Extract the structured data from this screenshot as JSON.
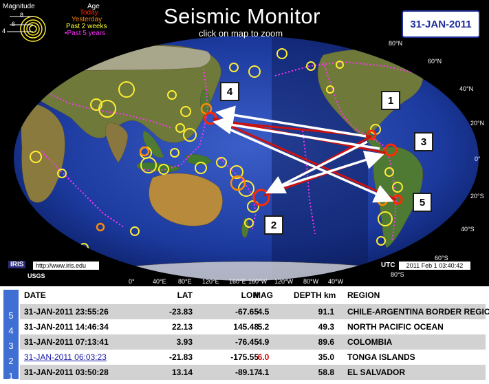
{
  "legend": {
    "magnitude_title": "Magnitude",
    "age_title": "Age",
    "scale": [
      "8",
      "6",
      "4"
    ],
    "ages": [
      {
        "label": "Today",
        "color": "#ff2a00"
      },
      {
        "label": "Yesterday",
        "color": "#ff8a00"
      },
      {
        "label": "Past 2 weeks",
        "color": "#ffff33"
      },
      {
        "label": "•Past 5 years",
        "color": "#ff33ff"
      }
    ]
  },
  "header": {
    "title": "Seismic Monitor",
    "subtitle": "click on map to zoom",
    "date_badge": "31-JAN-2011"
  },
  "map": {
    "lat_labels": [
      "80°N",
      "60°N",
      "40°N",
      "20°N",
      "0°",
      "20°S",
      "40°S",
      "60°S",
      "80°S"
    ],
    "lon_labels": [
      "0°",
      "40°E",
      "80°E",
      "120°E",
      "160°E",
      "160°W",
      "120°W",
      "80°W",
      "40°W"
    ],
    "iris_logo": "IRIS",
    "iris_url": "http://www.iris.edu",
    "usgs_logo": "USGS",
    "utc_label": "UTC",
    "utc_time": "2011 Feb  1 03:40:42",
    "callouts": [
      "1",
      "2",
      "3",
      "4",
      "5"
    ]
  },
  "table": {
    "headers": {
      "date": "DATE",
      "lat": "LAT",
      "lon": "LON",
      "mag": "MAG",
      "depth": "DEPTH km",
      "region": "REGION"
    },
    "rows": [
      {
        "rank": "5",
        "date": "31-JAN-2011 23:55:26",
        "lat": "-23.83",
        "lon": "-67.65",
        "mag": "4.5",
        "depth": "91.1",
        "region": "CHILE-ARGENTINA BORDER REGION"
      },
      {
        "rank": "4",
        "date": "31-JAN-2011 14:46:34",
        "lat": "22.13",
        "lon": "145.48",
        "mag": "5.2",
        "depth": "49.3",
        "region": "NORTH PACIFIC OCEAN"
      },
      {
        "rank": "3",
        "date": "31-JAN-2011 07:13:41",
        "lat": "3.93",
        "lon": "-76.45",
        "mag": "4.9",
        "depth": "89.6",
        "region": "COLOMBIA"
      },
      {
        "rank": "2",
        "date": "31-JAN-2011 06:03:23",
        "lat": "-21.83",
        "lon": "-175.55",
        "mag": "6.0",
        "depth": "35.0",
        "region": "TONGA ISLANDS"
      },
      {
        "rank": "1",
        "date": "31-JAN-2011 03:50:28",
        "lat": "13.14",
        "lon": "-89.17",
        "mag": "4.1",
        "depth": "58.8",
        "region": "EL SALVADOR"
      }
    ]
  }
}
